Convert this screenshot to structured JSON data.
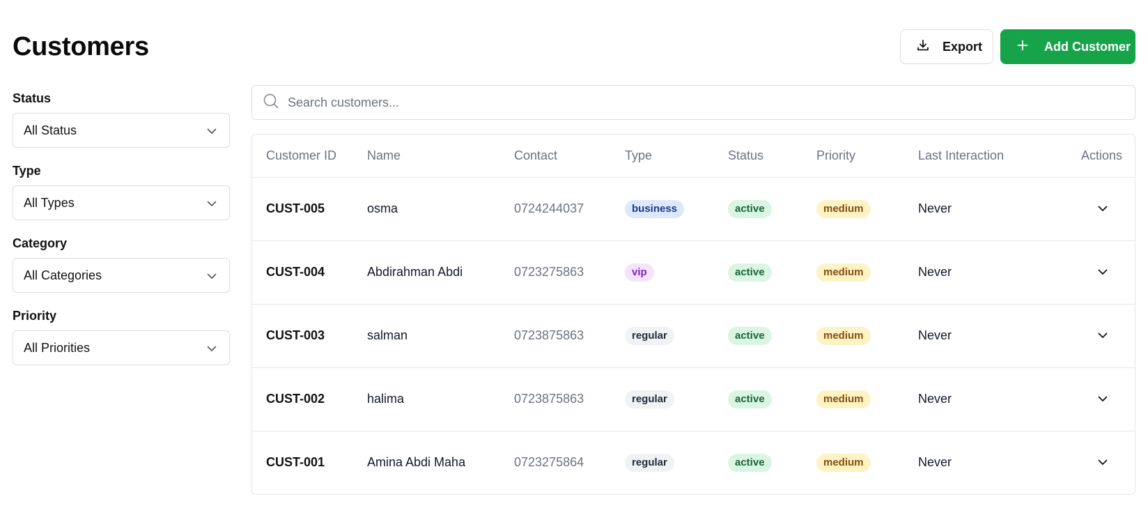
{
  "page": {
    "title": "Customers"
  },
  "actions": {
    "export_label": "Export",
    "add_label": "Add Customer"
  },
  "filters": {
    "status": {
      "label": "Status",
      "value": "All Status"
    },
    "type": {
      "label": "Type",
      "value": "All Types"
    },
    "category": {
      "label": "Category",
      "value": "All Categories"
    },
    "priority": {
      "label": "Priority",
      "value": "All Priorities"
    }
  },
  "search": {
    "placeholder": "Search customers...",
    "value": ""
  },
  "table": {
    "headers": [
      "Customer ID",
      "Name",
      "Contact",
      "Type",
      "Status",
      "Priority",
      "Last Interaction",
      "Actions"
    ],
    "rows": [
      {
        "id": "CUST-005",
        "name": "osma",
        "contact": "0724244037",
        "type": "business",
        "status": "active",
        "priority": "medium",
        "last": "Never"
      },
      {
        "id": "CUST-004",
        "name": "Abdirahman Abdi",
        "contact": "0723275863",
        "type": "vip",
        "status": "active",
        "priority": "medium",
        "last": "Never"
      },
      {
        "id": "CUST-003",
        "name": "salman",
        "contact": "0723875863",
        "type": "regular",
        "status": "active",
        "priority": "medium",
        "last": "Never"
      },
      {
        "id": "CUST-002",
        "name": "halima",
        "contact": "0723875863",
        "type": "regular",
        "status": "active",
        "priority": "medium",
        "last": "Never"
      },
      {
        "id": "CUST-001",
        "name": "Amina Abdi Maha",
        "contact": "0723275864",
        "type": "regular",
        "status": "active",
        "priority": "medium",
        "last": "Never"
      }
    ]
  },
  "icons": {
    "export": "download-icon",
    "add": "plus-icon",
    "search": "search-icon",
    "select": "chevron-down-icon",
    "row_toggle": "chevron-down-icon"
  },
  "colors": {
    "accent": "#16a34a",
    "business": "#dbe8fd",
    "vip": "#f3e4fb",
    "regular": "#f1f2f4",
    "active": "#daf5e3",
    "medium": "#fdf3c4"
  }
}
